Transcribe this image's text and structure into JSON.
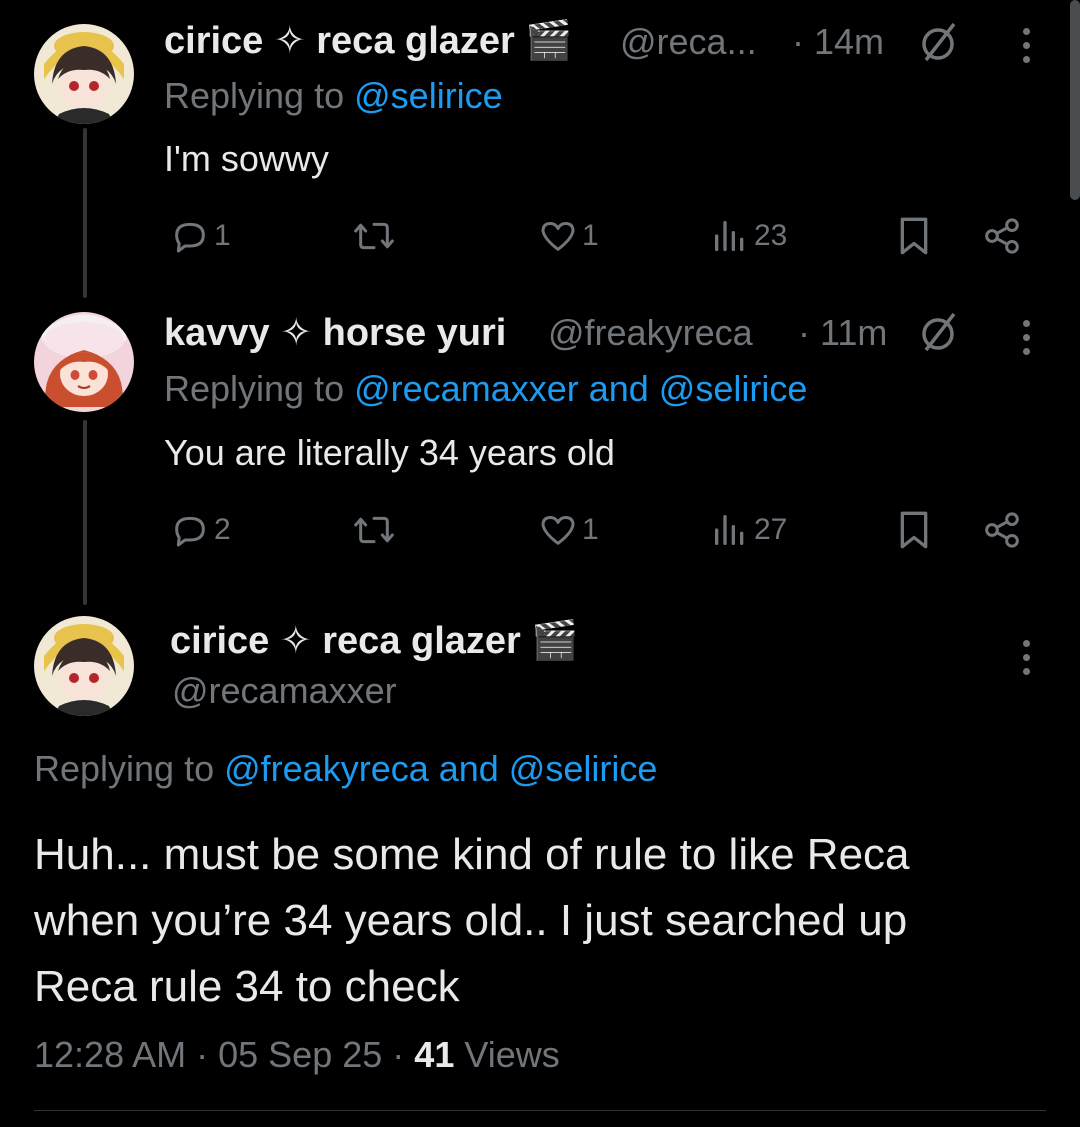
{
  "tweets": [
    {
      "name": "cirice ✧ reca glazer",
      "emoji": "🎬",
      "handle": "@reca...",
      "time": "· 14m",
      "replying_prefix": "Replying to",
      "mentions": "@selirice",
      "text": "I'm sowwy",
      "replies": "1",
      "likes": "1",
      "views": "23"
    },
    {
      "name": "kavvy ✧ horse yuri",
      "handle": "@freakyreca",
      "time": "· 11m",
      "replying_prefix": "Replying to",
      "mentions": "@recamaxxer and @selirice",
      "text": "You are literally 34 years old",
      "replies": "2",
      "likes": "1",
      "views": "27"
    }
  ],
  "main": {
    "name": "cirice ✧ reca glazer",
    "emoji": "🎬",
    "handle": "@recamaxxer",
    "replying_prefix": "Replying to",
    "mentions": "@freakyreca and @selirice",
    "text_lines": [
      "Huh... must be some kind of rule to like Reca",
      "when you’re 34 years old.. I just searched up",
      "Reca rule 34 to check"
    ],
    "time": "12:28 AM",
    "date": "05 Sep 25",
    "views_count": "41",
    "views_label": "Views"
  },
  "colors": {
    "accent": "#1d9bf0",
    "muted": "#71767b",
    "text": "#e7e9ea",
    "bg": "#000000"
  }
}
